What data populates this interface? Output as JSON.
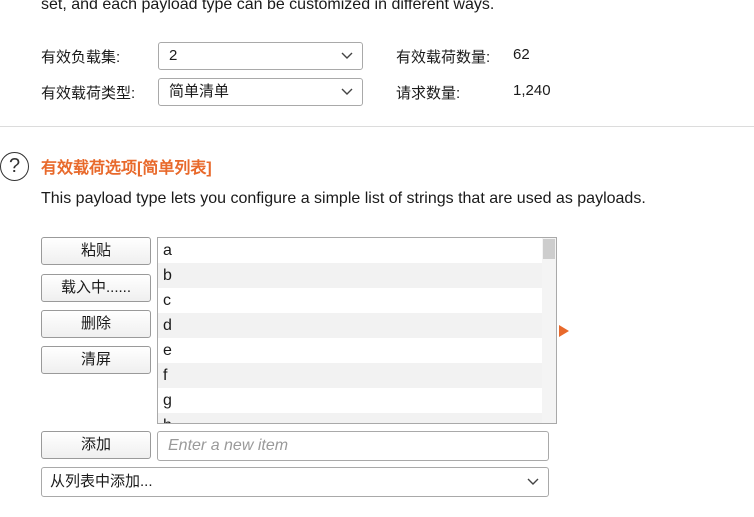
{
  "intro_text": "set, and each payload type can be customized in different ways.",
  "payload_set": {
    "label": "有效负载集:",
    "value": "2"
  },
  "payload_count": {
    "label": "有效载荷数量:",
    "value": "62"
  },
  "payload_type": {
    "label": "有效载荷类型:",
    "value": "简单清单"
  },
  "request_count": {
    "label": "请求数量:",
    "value": "1,240"
  },
  "options": {
    "title": "有效载荷选项[简单列表]",
    "description": "This payload type lets you configure a simple list of strings that are used as payloads.",
    "help_glyph": "?",
    "help_icon": "question-circle-icon"
  },
  "buttons": {
    "paste": "粘贴",
    "load": "载入中......",
    "remove": "删除",
    "clear": "清屏",
    "add": "添加"
  },
  "list_items": [
    "a",
    "b",
    "c",
    "d",
    "e",
    "f",
    "g",
    "h"
  ],
  "new_item": {
    "placeholder": "Enter a new item",
    "value": ""
  },
  "add_from_list": {
    "value": "从列表中添加..."
  },
  "colors": {
    "accent": "#e8692b",
    "row_alt": "#f2f2f2",
    "border": "#a9a9a9"
  }
}
